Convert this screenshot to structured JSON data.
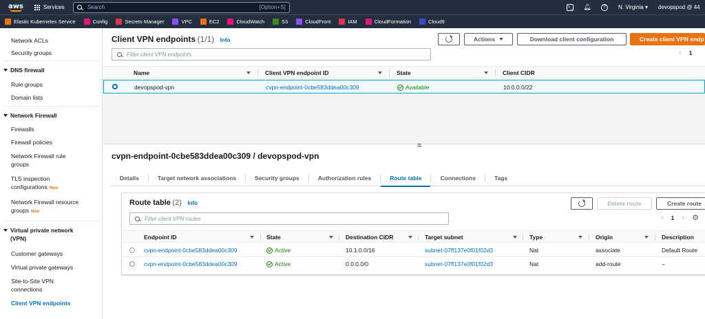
{
  "nav": {
    "logo": "aws",
    "services": "Services",
    "search_placeholder": "Search",
    "search_shortcut": "[Option+S]",
    "region": "N. Virginia",
    "account": "devopspod @ 44"
  },
  "favorites": [
    {
      "label": "Elastic Kubernetes Service",
      "color": "#ec7211"
    },
    {
      "label": "Config",
      "color": "#e7157b"
    },
    {
      "label": "Secrets Manager",
      "color": "#dd344c"
    },
    {
      "label": "VPC",
      "color": "#8c4fff"
    },
    {
      "label": "EC2",
      "color": "#ec7211"
    },
    {
      "label": "CloudWatch",
      "color": "#e7157b"
    },
    {
      "label": "S3",
      "color": "#3f8624"
    },
    {
      "label": "CloudFront",
      "color": "#8c4fff"
    },
    {
      "label": "IAM",
      "color": "#dd344c"
    },
    {
      "label": "CloudFormation",
      "color": "#e7157b"
    },
    {
      "label": "Cloud9",
      "color": "#3b48cc"
    }
  ],
  "sidebar": {
    "network_acls": "Network ACLs",
    "security_groups": "Security groups",
    "dns_firewall": "DNS firewall",
    "rule_groups": "Rule groups",
    "domain_lists": "Domain lists",
    "network_firewall": "Network Firewall",
    "firewalls": "Firewalls",
    "firewall_policies": "Firewall policies",
    "nf_rule_groups_1": "Network Firewall rule",
    "nf_rule_groups_2": "groups",
    "tls_1": "TLS inspection",
    "tls_2": "configurations",
    "new": "New",
    "nf_resource_1": "Network Firewall resource",
    "nf_resource_2": "groups",
    "vpn_1": "Virtual private network",
    "vpn_2": "(VPN)",
    "customer_gateways": "Customer gateways",
    "virtual_private_gateways": "Virtual private gateways",
    "s2s_1": "Site-to-Site VPN",
    "s2s_2": "connections",
    "client_vpn": "Client VPN endpoints"
  },
  "endpoints": {
    "title": "Client VPN endpoints",
    "count": "(1/1)",
    "info": "Info",
    "actions": "Actions",
    "download": "Download client configuration",
    "create": "Create client VPN endp",
    "filter_placeholder": "Filter client VPN endpoints",
    "page": "1",
    "columns": [
      "Name",
      "Client VPN endpoint ID",
      "State",
      "Client CIDR"
    ],
    "row": {
      "name": "devopspod-vpn",
      "id": "cvpn-endpoint-0cbe583ddea00c309",
      "state": "Available",
      "cidr": "10.0.0.0/22"
    }
  },
  "splitter": "=",
  "detail": {
    "title": "cvpn-endpoint-0cbe583ddea00c309 / devopspod-vpn",
    "tabs": [
      "Details",
      "Target network associations",
      "Security groups",
      "Authorization rules",
      "Route table",
      "Connections",
      "Tags"
    ],
    "active_tab": "Route table"
  },
  "routes": {
    "title": "Route table",
    "count": "(2)",
    "info": "Info",
    "delete": "Delete route",
    "create": "Create route",
    "filter_placeholder": "Filter client VPN routes",
    "page": "1",
    "columns": [
      "Endpoint ID",
      "State",
      "Destination CIDR",
      "Target subnet",
      "Type",
      "Origin",
      "Description"
    ],
    "rows": [
      {
        "endpoint": "cvpn-endpoint-0cbe583ddea00c309",
        "state": "Active",
        "cidr": "10.1.0.0/16",
        "subnet": "subnet-07ff137e0f01f02d3",
        "type": "Nat",
        "origin": "associate",
        "description": "Default Route"
      },
      {
        "endpoint": "cvpn-endpoint-0cbe583ddea00c309",
        "state": "Active",
        "cidr": "0.0.0.0/0",
        "subnet": "subnet-07ff137e0f01f02d3",
        "type": "Nat",
        "origin": "add-route",
        "description": "–"
      }
    ]
  }
}
